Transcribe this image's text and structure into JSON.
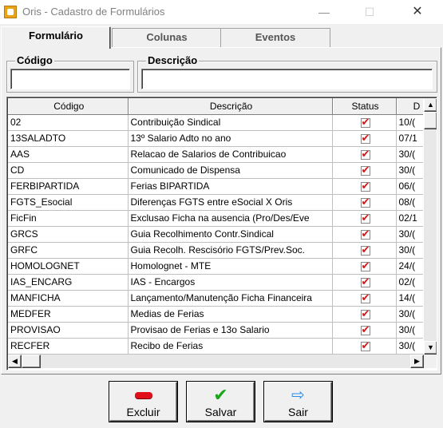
{
  "window": {
    "title": "Oris - Cadastro de Formulários",
    "minimize": "—",
    "maximize": "☐",
    "close": "✕"
  },
  "tabs": [
    {
      "label": "Formulário"
    },
    {
      "label": "Colunas"
    },
    {
      "label": "Eventos"
    }
  ],
  "filters": {
    "codigo_label": "Código",
    "codigo_value": "",
    "descricao_label": "Descrição",
    "descricao_value": ""
  },
  "grid": {
    "columns": [
      "Código",
      "Descrição",
      "Status",
      "D"
    ],
    "rows": [
      {
        "codigo": "02",
        "descricao": "Contribuição Sindical",
        "status": true,
        "d": "10/("
      },
      {
        "codigo": "13SALADTO",
        "descricao": "13º Salario Adto no ano",
        "status": true,
        "d": "07/1"
      },
      {
        "codigo": "AAS",
        "descricao": "Relacao de Salarios de Contribuicao",
        "status": true,
        "d": "30/("
      },
      {
        "codigo": "CD",
        "descricao": "Comunicado de Dispensa",
        "status": true,
        "d": "30/("
      },
      {
        "codigo": "FERBIPARTIDA",
        "descricao": "Ferias BIPARTIDA",
        "status": true,
        "d": "06/("
      },
      {
        "codigo": "FGTS_Esocial",
        "descricao": "Diferenças FGTS entre eSocial X Oris",
        "status": true,
        "d": "08/("
      },
      {
        "codigo": "FicFin",
        "descricao": "Exclusao Ficha na ausencia (Pro/Des/Eve",
        "status": true,
        "d": "02/1"
      },
      {
        "codigo": "GRCS",
        "descricao": "Guia Recolhimento Contr.Sindical",
        "status": true,
        "d": "30/("
      },
      {
        "codigo": "GRFC",
        "descricao": "Guia Recolh. Rescisório FGTS/Prev.Soc.",
        "status": true,
        "d": "30/("
      },
      {
        "codigo": "HOMOLOGNET",
        "descricao": "Homolognet - MTE",
        "status": true,
        "d": "24/("
      },
      {
        "codigo": "IAS_ENCARG",
        "descricao": "IAS - Encargos",
        "status": true,
        "d": "02/("
      },
      {
        "codigo": "MANFICHA",
        "descricao": "Lançamento/Manutenção Ficha Financeira",
        "status": true,
        "d": "14/("
      },
      {
        "codigo": "MEDFER",
        "descricao": "Medias de Ferias",
        "status": true,
        "d": "30/("
      },
      {
        "codigo": "PROVISAO",
        "descricao": "Provisao de Ferias e 13o Salario",
        "status": true,
        "d": "30/("
      },
      {
        "codigo": "RECFER",
        "descricao": "Recibo de Ferias",
        "status": true,
        "d": "30/("
      }
    ]
  },
  "scroll": {
    "up": "▲",
    "down": "▼",
    "left": "◀",
    "right": "▶"
  },
  "buttons": {
    "excluir": {
      "label": "Excluir",
      "icon": "minus-icon"
    },
    "salvar": {
      "label": "Salvar",
      "icon": "check-icon"
    },
    "sair": {
      "label": "Sair",
      "icon": "arrow-right-icon"
    }
  }
}
